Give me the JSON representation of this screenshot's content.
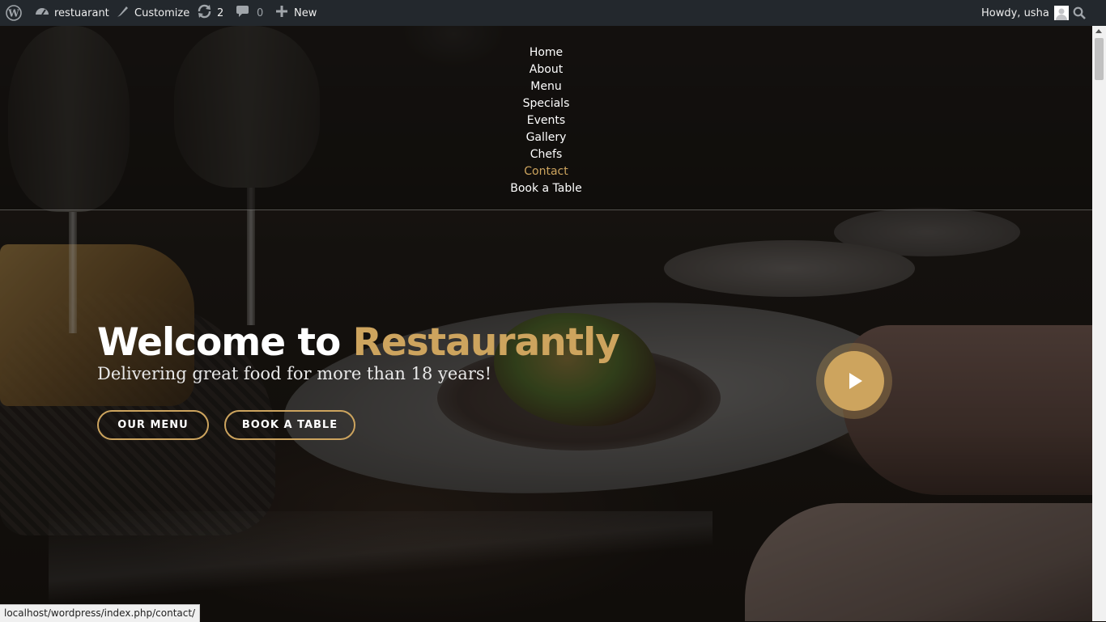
{
  "adminbar": {
    "site_name": "restuarant",
    "customize": "Customize",
    "updates": "2",
    "comments": "0",
    "new": "New",
    "howdy": "Howdy, usha"
  },
  "nav": {
    "items": [
      "Home",
      "About",
      "Menu",
      "Specials",
      "Events",
      "Gallery",
      "Chefs",
      "Contact",
      "Book a Table"
    ],
    "active": "Contact"
  },
  "hero": {
    "title_prefix": "Welcome to ",
    "title_accent": "Restaurantly",
    "subtitle": "Delivering great food for more than 18 years!",
    "btn_menu": "OUR MENU",
    "btn_book": "BOOK A TABLE"
  },
  "status_url": "localhost/wordpress/index.php/contact/",
  "colors": {
    "accent": "#cda45e",
    "adminbar_bg": "#23282d"
  },
  "icons": [
    "wordpress-icon",
    "dashboard-icon",
    "customize-icon",
    "updates-icon",
    "comments-icon",
    "plus-icon",
    "avatar",
    "search-icon",
    "play-icon"
  ]
}
